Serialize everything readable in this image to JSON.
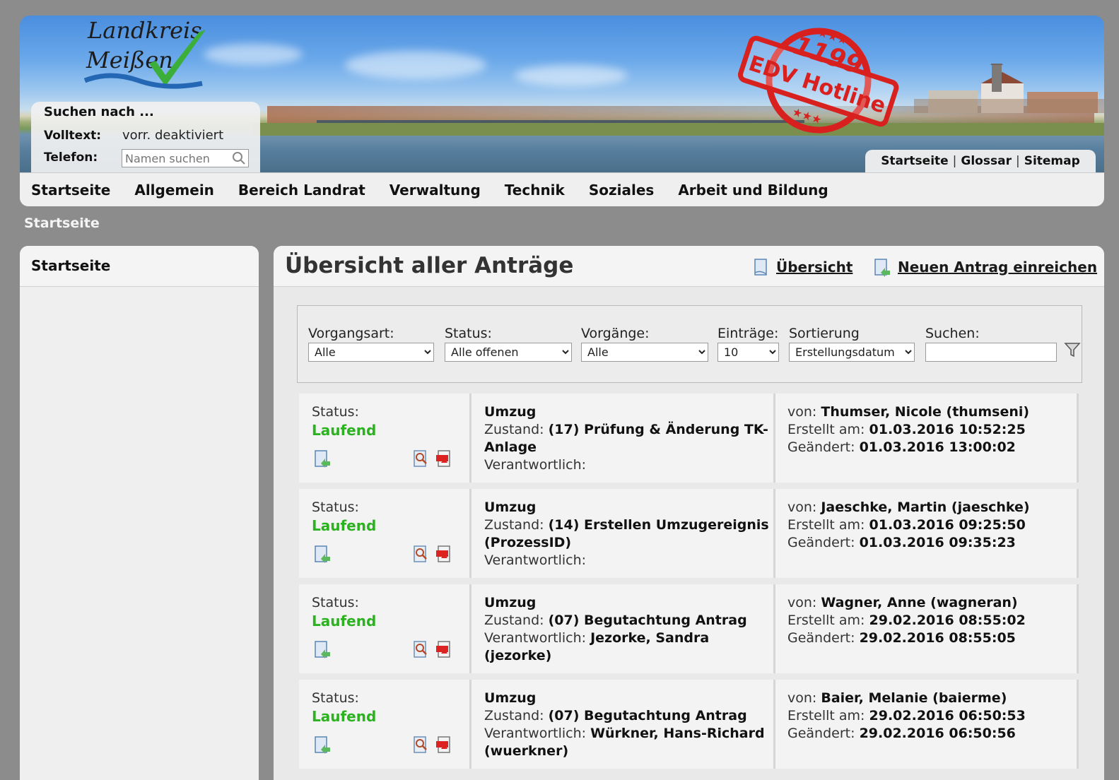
{
  "logo": {
    "line1": "Landkreis",
    "line2": "Meißen"
  },
  "stamp": {
    "number": "1199",
    "text": "EDV Hotline"
  },
  "search": {
    "title": "Suchen nach ...",
    "volltext_label": "Volltext:",
    "volltext_value": "vorr. deaktiviert",
    "telefon_label": "Telefon:",
    "telefon_placeholder": "Namen suchen"
  },
  "quicklinks": [
    "Startseite",
    "Glossar",
    "Sitemap"
  ],
  "nav": [
    "Startseite",
    "Allgemein",
    "Bereich Landrat",
    "Verwaltung",
    "Technik",
    "Soziales",
    "Arbeit und Bildung"
  ],
  "breadcrumb": "Startseite",
  "sidebar": {
    "title": "Startseite"
  },
  "main": {
    "title": "Übersicht aller Anträge",
    "link_overview": "Übersicht",
    "link_new": "Neuen Antrag einreichen"
  },
  "filters": {
    "vorgangsart": {
      "label": "Vorgangsart:",
      "value": "Alle"
    },
    "status": {
      "label": "Status:",
      "value": "Alle offenen"
    },
    "vorgaenge": {
      "label": "Vorgänge:",
      "value": "Alle"
    },
    "eintraege": {
      "label": "Einträge:",
      "value": "10"
    },
    "sortierung": {
      "label": "Sortierung",
      "value": "Erstellungsdatum"
    },
    "suchen": {
      "label": "Suchen:",
      "value": ""
    }
  },
  "labels": {
    "status": "Status:",
    "zustand": "Zustand:",
    "verantwortlich": "Verantwortlich:",
    "von": "von:",
    "erstellt": "Erstellt am:",
    "geaendert": "Geändert:"
  },
  "records": [
    {
      "status": "Laufend",
      "type": "Umzug",
      "zustand": "(17) Prüfung & Änderung TK-Anlage",
      "verantwortlich": "",
      "von": "Thumser, Nicole (thumseni)",
      "erstellt": "01.03.2016 10:52:25",
      "geaendert": "01.03.2016 13:00:02"
    },
    {
      "status": "Laufend",
      "type": "Umzug",
      "zustand": "(14) Erstellen Umzugereignis (ProzessID)",
      "verantwortlich": "",
      "von": "Jaeschke, Martin (jaeschke)",
      "erstellt": "01.03.2016 09:25:50",
      "geaendert": "01.03.2016 09:35:23"
    },
    {
      "status": "Laufend",
      "type": "Umzug",
      "zustand": "(07) Begutachtung Antrag",
      "verantwortlich": "Jezorke, Sandra (jezorke)",
      "von": "Wagner, Anne (wagneran)",
      "erstellt": "29.02.2016 08:55:02",
      "geaendert": "29.02.2016 08:55:05"
    },
    {
      "status": "Laufend",
      "type": "Umzug",
      "zustand": "(07) Begutachtung Antrag",
      "verantwortlich": "Würkner, Hans-Richard (wuerkner)",
      "von": "Baier, Melanie (baierme)",
      "erstellt": "29.02.2016 06:50:53",
      "geaendert": "29.02.2016 06:50:56"
    }
  ],
  "colors": {
    "status_green": "#2bb31f",
    "stamp_red": "#d8201e",
    "logo_green": "#3cae3a",
    "logo_blue": "#2467b4"
  }
}
